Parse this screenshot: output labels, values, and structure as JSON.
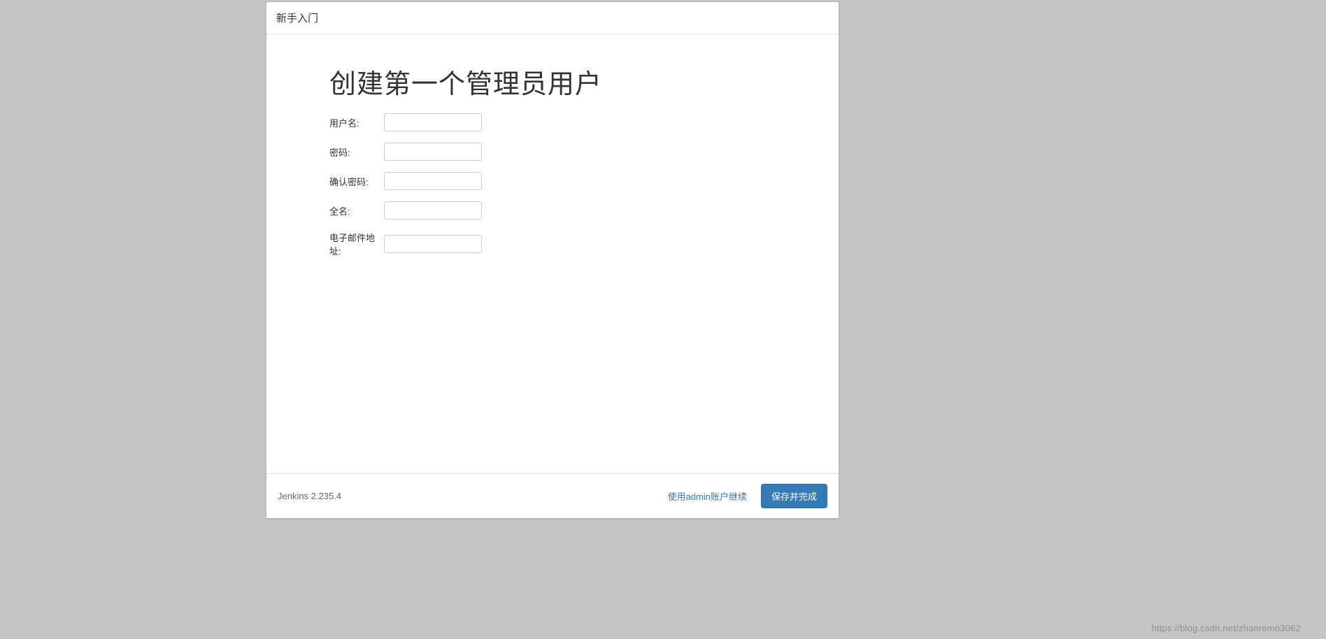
{
  "header": {
    "title": "新手入门"
  },
  "main": {
    "title": "创建第一个管理员用户",
    "fields": {
      "username_label": "用户名:",
      "password_label": "密码:",
      "confirm_password_label": "确认密码:",
      "fullname_label": "全名:",
      "email_label": "电子邮件地址:"
    }
  },
  "footer": {
    "version": "Jenkins 2.235.4",
    "continue_admin": "使用admin账户继续",
    "save_finish": "保存并完成"
  },
  "watermark": "https://blog.csdn.net/zhanremo3062"
}
